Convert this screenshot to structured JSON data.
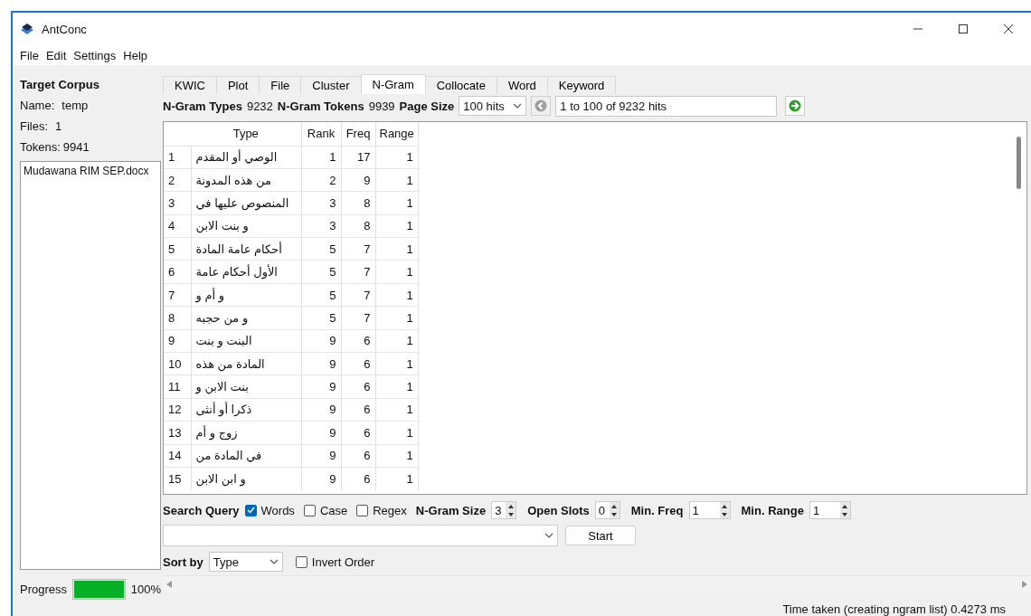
{
  "window": {
    "title": "AntConc"
  },
  "menu": [
    "File",
    "Edit",
    "Settings",
    "Help"
  ],
  "corpus": {
    "heading": "Target Corpus",
    "name_label": "Name:",
    "name": "temp",
    "files_label": "Files:",
    "files": "1",
    "tokens_label": "Tokens:",
    "tokens": "9941"
  },
  "file_list": [
    "Mudawana RIM SEP.docx"
  ],
  "progress": {
    "label": "Progress",
    "level": 1,
    "reading": "100%"
  },
  "tabs": [
    {
      "label": "KWIC",
      "selected": false
    },
    {
      "label": "Plot",
      "selected": false
    },
    {
      "label": "File",
      "selected": false
    },
    {
      "label": "Cluster",
      "selected": false
    },
    {
      "label": "N-Gram",
      "selected": true
    },
    {
      "label": "Collocate",
      "selected": false
    },
    {
      "label": "Word",
      "selected": false
    },
    {
      "label": "Keyword",
      "selected": false
    }
  ],
  "stats": {
    "types_label": "N-Gram Types",
    "types": "9232",
    "tokens_label": "N-Gram Tokens",
    "tokens": "9939",
    "page_size_label": "Page Size",
    "page_size": "100 hits",
    "hits": "1 to 100 of 9232 hits"
  },
  "table": {
    "columns": [
      "Type",
      "Rank",
      "Freq",
      "Range"
    ],
    "rows": [
      {
        "n": "1",
        "type": "الوصي أو المقدم",
        "rank": "1",
        "freq": "17",
        "range": "1"
      },
      {
        "n": "2",
        "type": "من هذه المدونة",
        "rank": "2",
        "freq": "9",
        "range": "1"
      },
      {
        "n": "3",
        "type": "المنصوص عليها في",
        "rank": "3",
        "freq": "8",
        "range": "1"
      },
      {
        "n": "4",
        "type": "و بنت الابن",
        "rank": "3",
        "freq": "8",
        "range": "1"
      },
      {
        "n": "5",
        "type": "أحكام عامة المادة",
        "rank": "5",
        "freq": "7",
        "range": "1"
      },
      {
        "n": "6",
        "type": "الأول أحكام عامة",
        "rank": "5",
        "freq": "7",
        "range": "1"
      },
      {
        "n": "7",
        "type": "و أم و",
        "rank": "5",
        "freq": "7",
        "range": "1"
      },
      {
        "n": "8",
        "type": "و من حجبه",
        "rank": "5",
        "freq": "7",
        "range": "1"
      },
      {
        "n": "9",
        "type": "البنت و بنت",
        "rank": "9",
        "freq": "6",
        "range": "1"
      },
      {
        "n": "10",
        "type": "المادة من هذه",
        "rank": "9",
        "freq": "6",
        "range": "1"
      },
      {
        "n": "11",
        "type": "بنت الابن و",
        "rank": "9",
        "freq": "6",
        "range": "1"
      },
      {
        "n": "12",
        "type": "ذكرا أو أنثى",
        "rank": "9",
        "freq": "6",
        "range": "1"
      },
      {
        "n": "13",
        "type": "زوج و أم",
        "rank": "9",
        "freq": "6",
        "range": "1"
      },
      {
        "n": "14",
        "type": "في المادة من",
        "rank": "9",
        "freq": "6",
        "range": "1"
      },
      {
        "n": "15",
        "type": "و ابن الابن",
        "rank": "9",
        "freq": "6",
        "range": "1"
      }
    ]
  },
  "query": {
    "label": "Search Query",
    "options": [
      {
        "label": "Words",
        "checked": true
      },
      {
        "label": "Case",
        "checked": false
      },
      {
        "label": "Regex",
        "checked": false
      }
    ],
    "spinners": [
      {
        "label": "N-Gram Size",
        "value": "3"
      },
      {
        "label": "Open Slots",
        "value": "0"
      },
      {
        "label": "Min. Freq",
        "value": "1"
      },
      {
        "label": "Min. Range",
        "value": "1"
      }
    ],
    "start": "Start"
  },
  "sort": {
    "label": "Sort by",
    "value": "Type",
    "invert": {
      "label": "Invert Order",
      "checked": false
    }
  },
  "status": "Time taken (creating ngram list) 0.4273 ms"
}
